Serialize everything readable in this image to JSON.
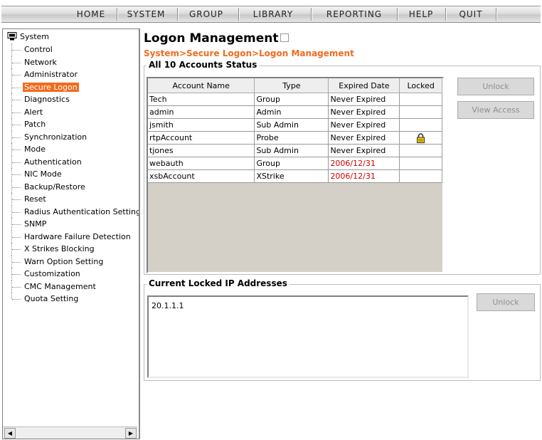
{
  "nav": {
    "items": [
      "HOME",
      "SYSTEM",
      "GROUP",
      "LIBRARY",
      "REPORTING",
      "HELP",
      "QUIT"
    ]
  },
  "sidebar": {
    "root": "System",
    "items": [
      "Control",
      "Network",
      "Administrator",
      "Secure Logon",
      "Diagnostics",
      "Alert",
      "Patch",
      "Synchronization",
      "Mode",
      "Authentication",
      "NIC Mode",
      "Backup/Restore",
      "Reset",
      "Radius Authentication Setting",
      "SNMP",
      "Hardware Failure Detection",
      "X Strikes Blocking",
      "Warn Option Setting",
      "Customization",
      "CMC Management",
      "Quota Setting"
    ],
    "selected": "Secure Logon"
  },
  "page": {
    "title": "Logon Management",
    "breadcrumb": "System>Secure Logon>Logon Management"
  },
  "accounts": {
    "legend": "All 10 Accounts Status",
    "columns": [
      "Account Name",
      "Type",
      "Expired Date",
      "Locked"
    ],
    "rows": [
      {
        "name": "Tech",
        "type": "Group",
        "expired": "Never Expired",
        "locked": false
      },
      {
        "name": "admin",
        "type": "Admin",
        "expired": "Never Expired",
        "locked": false
      },
      {
        "name": "jsmith",
        "type": "Sub Admin",
        "expired": "Never Expired",
        "locked": false
      },
      {
        "name": "rtpAccount",
        "type": "Probe",
        "expired": "Never Expired",
        "locked": true
      },
      {
        "name": "tjones",
        "type": "Sub Admin",
        "expired": "Never Expired",
        "locked": false
      },
      {
        "name": "webauth",
        "type": "Group",
        "expired": "2006/12/31",
        "locked": false
      },
      {
        "name": "xsbAccount",
        "type": "XStrike",
        "expired": "2006/12/31",
        "locked": false
      }
    ],
    "unlock_label": "Unlock",
    "view_access_label": "View Access"
  },
  "locked_ips": {
    "legend": "Current Locked IP Addresses",
    "addresses": [
      "20.1.1.1"
    ],
    "unlock_label": "Unlock"
  },
  "colors": {
    "accent": "#f26b1d",
    "expired_red": "#cc0000"
  }
}
